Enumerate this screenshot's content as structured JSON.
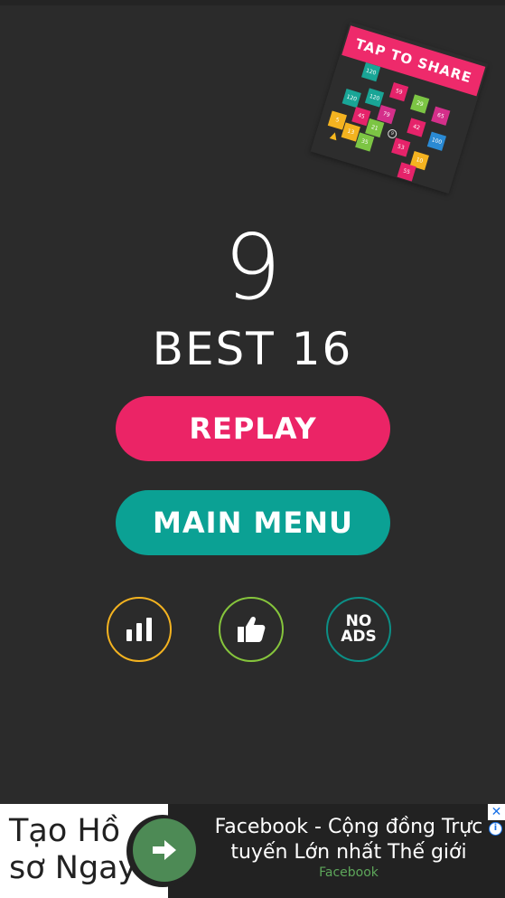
{
  "share": {
    "label": "TAP TO SHARE",
    "tiles": [
      {
        "v": "120",
        "c": "#19a596"
      },
      {
        "v": "59",
        "c": "#e5236a"
      },
      {
        "v": "29",
        "c": "#7cc544"
      },
      {
        "v": "65",
        "c": "#d42f8a"
      },
      {
        "v": "120",
        "c": "#19a596"
      },
      {
        "v": "79",
        "c": "#d42f8a"
      },
      {
        "v": "120",
        "c": "#19a596"
      },
      {
        "v": "45",
        "c": "#e5236a"
      },
      {
        "v": "21",
        "c": "#7cc544"
      },
      {
        "v": "42",
        "c": "#e5236a"
      },
      {
        "v": "100",
        "c": "#2a8ad4"
      },
      {
        "v": "5",
        "c": "#f4b320"
      },
      {
        "v": "13",
        "c": "#f4b320"
      },
      {
        "v": "35",
        "c": "#7cc544"
      },
      {
        "v": "53",
        "c": "#e5236a"
      },
      {
        "v": "10",
        "c": "#f4b320"
      },
      {
        "v": "55",
        "c": "#e5236a"
      }
    ],
    "ball_label": "9"
  },
  "score": "9",
  "best": "BEST 16",
  "buttons": {
    "replay": "REPLAY",
    "main_menu": "MAIN MENU",
    "no_ads_line1": "NO",
    "no_ads_line2": "ADS"
  },
  "icons": {
    "leaderboard": "bar-chart-icon",
    "rate": "thumbs-up-icon"
  },
  "colors": {
    "background": "#2b2b2b",
    "replay": "#eb2466",
    "main_menu": "#0ba194",
    "leaderboard_ring": "#f4b320",
    "rate_ring": "#86c53c",
    "noads_ring": "#0c8f86"
  },
  "ad": {
    "left_line1": "Tạo Hồ",
    "left_line2": "sơ Ngay",
    "title_line1": "Facebook - Cộng đồng Trực",
    "title_line2": "tuyến Lớn nhất Thế giới",
    "source": "Facebook",
    "close": "✕",
    "info": "i"
  }
}
